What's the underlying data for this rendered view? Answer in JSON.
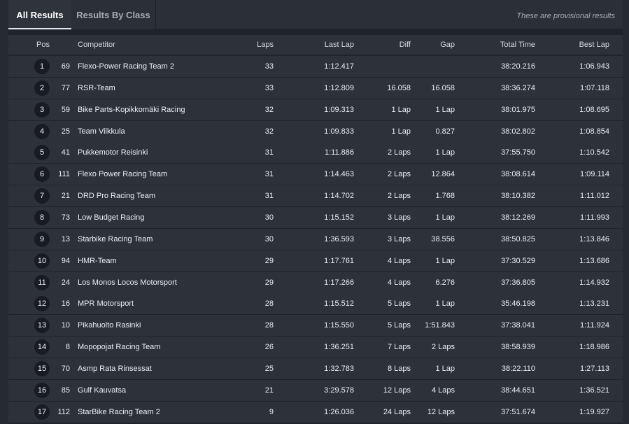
{
  "tabs": [
    {
      "label": "All Results",
      "active": true
    },
    {
      "label": "Results By Class",
      "active": false
    }
  ],
  "notice": "These are provisional results",
  "columns": {
    "pos": "Pos",
    "competitor": "Competitor",
    "laps": "Laps",
    "last_lap": "Last Lap",
    "diff": "Diff",
    "gap": "Gap",
    "total_time": "Total Time",
    "best_lap": "Best Lap"
  },
  "rows": [
    {
      "pos": "1",
      "no": "69",
      "competitor": "Flexo-Power Racing Team 2",
      "laps": "33",
      "last_lap": "1:12.417",
      "diff": "",
      "gap": "",
      "total_time": "38:20.216",
      "best_lap": "1:06.943"
    },
    {
      "pos": "2",
      "no": "77",
      "competitor": "RSR-Team",
      "laps": "33",
      "last_lap": "1:12.809",
      "diff": "16.058",
      "gap": "16.058",
      "total_time": "38:36.274",
      "best_lap": "1:07.118"
    },
    {
      "pos": "3",
      "no": "59",
      "competitor": "Bike Parts-Kopikkomäki Racing",
      "laps": "32",
      "last_lap": "1:09.313",
      "diff": "1 Lap",
      "gap": "1 Lap",
      "total_time": "38:01.975",
      "best_lap": "1:08.695"
    },
    {
      "pos": "4",
      "no": "25",
      "competitor": "Team Vilkkula",
      "laps": "32",
      "last_lap": "1:09.833",
      "diff": "1 Lap",
      "gap": "0.827",
      "total_time": "38:02.802",
      "best_lap": "1:08.854"
    },
    {
      "pos": "5",
      "no": "41",
      "competitor": "Pukkemotor Reisinki",
      "laps": "31",
      "last_lap": "1:11.886",
      "diff": "2 Laps",
      "gap": "1 Lap",
      "total_time": "37:55.750",
      "best_lap": "1:10.542"
    },
    {
      "pos": "6",
      "no": "111",
      "competitor": "Flexo Power Racing Team",
      "laps": "31",
      "last_lap": "1:14.463",
      "diff": "2 Laps",
      "gap": "12.864",
      "total_time": "38:08.614",
      "best_lap": "1:09.114"
    },
    {
      "pos": "7",
      "no": "21",
      "competitor": "DRD Pro Racing Team",
      "laps": "31",
      "last_lap": "1:14.702",
      "diff": "2 Laps",
      "gap": "1.768",
      "total_time": "38:10.382",
      "best_lap": "1:11.012"
    },
    {
      "pos": "8",
      "no": "73",
      "competitor": "Low Budget Racing",
      "laps": "30",
      "last_lap": "1:15.152",
      "diff": "3 Laps",
      "gap": "1 Lap",
      "total_time": "38:12.269",
      "best_lap": "1:11.993"
    },
    {
      "pos": "9",
      "no": "13",
      "competitor": "Starbike Racing Team",
      "laps": "30",
      "last_lap": "1:36.593",
      "diff": "3 Laps",
      "gap": "38.556",
      "total_time": "38:50.825",
      "best_lap": "1:13.846"
    },
    {
      "pos": "10",
      "no": "94",
      "competitor": "HMR-Team",
      "laps": "29",
      "last_lap": "1:17.761",
      "diff": "4 Laps",
      "gap": "1 Lap",
      "total_time": "37:30.529",
      "best_lap": "1:13.686"
    },
    {
      "pos": "11",
      "no": "24",
      "competitor": "Los Monos Locos Motorsport",
      "laps": "29",
      "last_lap": "1:17.266",
      "diff": "4 Laps",
      "gap": "6.276",
      "total_time": "37:36.805",
      "best_lap": "1:14.932"
    },
    {
      "pos": "12",
      "no": "16",
      "competitor": "MPR Motorsport",
      "laps": "28",
      "last_lap": "1:15.512",
      "diff": "5 Laps",
      "gap": "1 Lap",
      "total_time": "35:46.198",
      "best_lap": "1:13.231"
    },
    {
      "pos": "13",
      "no": "10",
      "competitor": "Pikahuolto Rasinki",
      "laps": "28",
      "last_lap": "1:15.550",
      "diff": "5 Laps",
      "gap": "1:51.843",
      "total_time": "37:38.041",
      "best_lap": "1:11.924"
    },
    {
      "pos": "14",
      "no": "8",
      "competitor": "Mopopojat Racing Team",
      "laps": "26",
      "last_lap": "1:36.251",
      "diff": "7 Laps",
      "gap": "2 Laps",
      "total_time": "38:58.939",
      "best_lap": "1:18.986"
    },
    {
      "pos": "15",
      "no": "70",
      "competitor": "Asmp Rata Rinsessat",
      "laps": "25",
      "last_lap": "1:32.783",
      "diff": "8 Laps",
      "gap": "1 Lap",
      "total_time": "38:22.110",
      "best_lap": "1:27.113"
    },
    {
      "pos": "16",
      "no": "85",
      "competitor": "Gulf Kauvatsa",
      "laps": "21",
      "last_lap": "3:29.578",
      "diff": "12 Laps",
      "gap": "4 Laps",
      "total_time": "38:44.651",
      "best_lap": "1:36.521"
    },
    {
      "pos": "17",
      "no": "112",
      "competitor": "StarBike Racing Team 2",
      "laps": "9",
      "last_lap": "1:26.036",
      "diff": "24 Laps",
      "gap": "12 Laps",
      "total_time": "37:51.674",
      "best_lap": "1:19.927"
    }
  ]
}
